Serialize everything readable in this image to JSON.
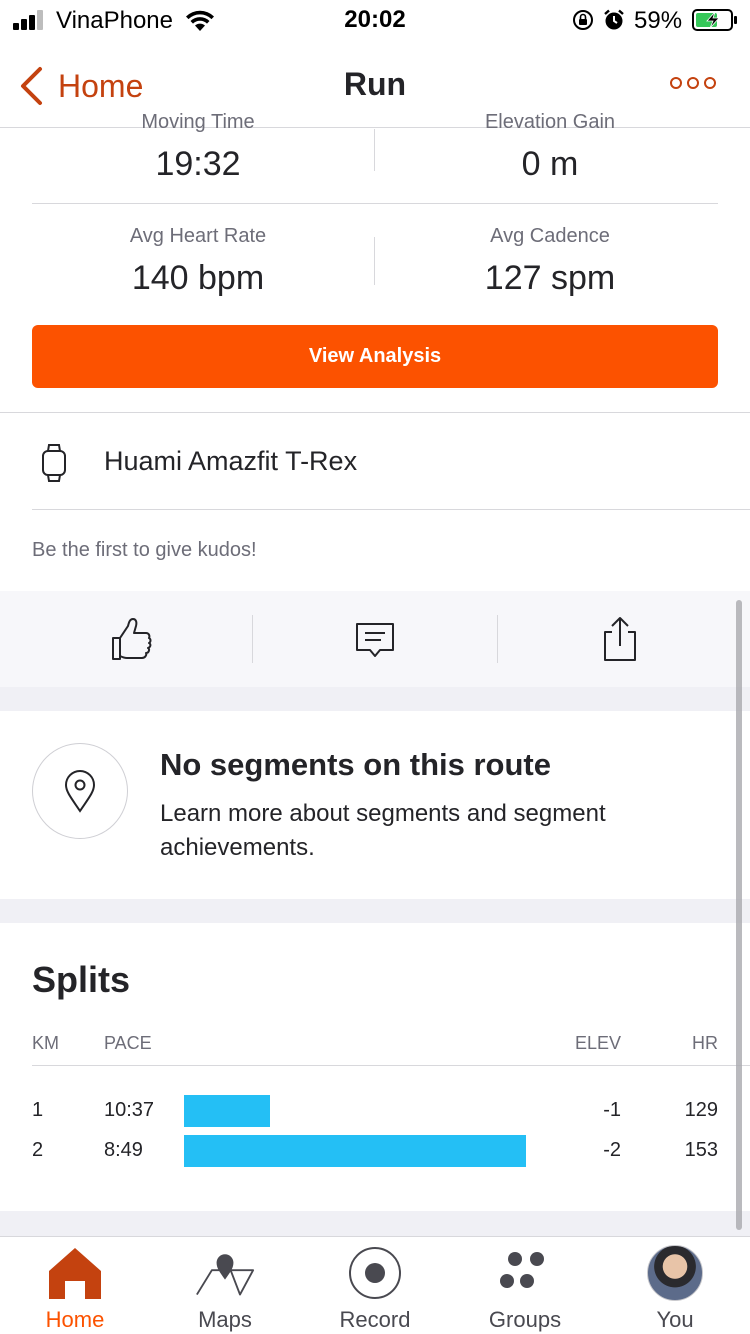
{
  "status_bar": {
    "carrier": "VinaPhone",
    "time": "20:02",
    "battery_percent": "59%"
  },
  "nav": {
    "back_label": "Home",
    "title": "Run"
  },
  "stats": {
    "moving_time_label": "Moving Time",
    "moving_time_value": "19:32",
    "elevation_gain_label": "Elevation Gain",
    "elevation_gain_value": "0 m",
    "avg_heart_rate_label": "Avg Heart Rate",
    "avg_heart_rate_value": "140 bpm",
    "avg_cadence_label": "Avg Cadence",
    "avg_cadence_value": "127 spm"
  },
  "view_analysis_label": "View Analysis",
  "device": {
    "name": "Huami Amazfit T-Rex"
  },
  "kudos_prompt": "Be the first to give kudos!",
  "segments": {
    "title": "No segments on this route",
    "description": "Learn more about segments and segment achievements."
  },
  "splits": {
    "title": "Splits",
    "headers": {
      "km": "KM",
      "pace": "PACE",
      "elev": "ELEV",
      "hr": "HR"
    },
    "rows": [
      {
        "km": "1",
        "pace": "10:37",
        "pace_fraction": 0.25,
        "elev": "-1",
        "hr": "129"
      },
      {
        "km": "2",
        "pace": "8:49",
        "pace_fraction": 1.0,
        "elev": "-2",
        "hr": "153"
      }
    ],
    "bar_color": "#24BFF5"
  },
  "tabs": [
    {
      "label": "Home",
      "icon": "home-icon",
      "active": true
    },
    {
      "label": "Maps",
      "icon": "map-pin-icon",
      "active": false
    },
    {
      "label": "Record",
      "icon": "record-icon",
      "active": false
    },
    {
      "label": "Groups",
      "icon": "groups-icon",
      "active": false
    },
    {
      "label": "You",
      "icon": "avatar",
      "active": false
    }
  ],
  "colors": {
    "brand": "#FC5200",
    "link": "#C4420F"
  }
}
